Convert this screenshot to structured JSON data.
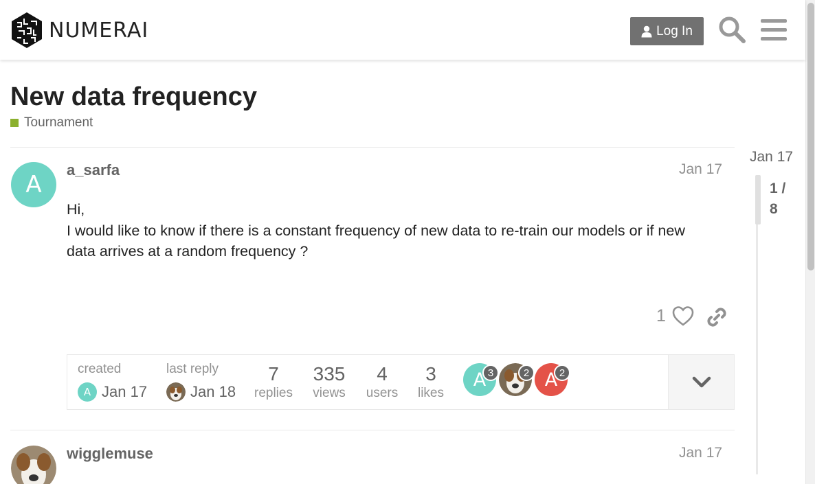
{
  "header": {
    "brand": "NUMERAI",
    "login_label": "Log In"
  },
  "topic": {
    "title": "New data frequency",
    "category": "Tournament",
    "category_color": "#8bb02e"
  },
  "posts": [
    {
      "avatar_letter": "A",
      "avatar_color": "#6ed4c5",
      "username": "a_sarfa",
      "date": "Jan 17",
      "body_lines": [
        "Hi,",
        "I would like to know if there is a constant frequency of new data to re-train our models or if new data arrives at a random frequency ?"
      ],
      "likes": "1"
    },
    {
      "avatar_icon": "dog-avatar",
      "username": "wigglemuse",
      "date": "Jan 17"
    }
  ],
  "topic_map": {
    "created_label": "created",
    "created_date": "Jan 17",
    "last_reply_label": "last reply",
    "last_reply_date": "Jan 18",
    "stats": [
      {
        "num": "7",
        "label": "replies"
      },
      {
        "num": "335",
        "label": "views"
      },
      {
        "num": "4",
        "label": "users"
      },
      {
        "num": "3",
        "label": "likes"
      }
    ],
    "participants": [
      {
        "letter": "A",
        "color": "#6ed4c5",
        "count": "3"
      },
      {
        "icon": "dog-avatar",
        "count": "2"
      },
      {
        "letter": "A",
        "color": "#e45248",
        "count": "2"
      }
    ]
  },
  "timeline": {
    "top_date": "Jan 17",
    "position": "1 /",
    "total": "8"
  }
}
